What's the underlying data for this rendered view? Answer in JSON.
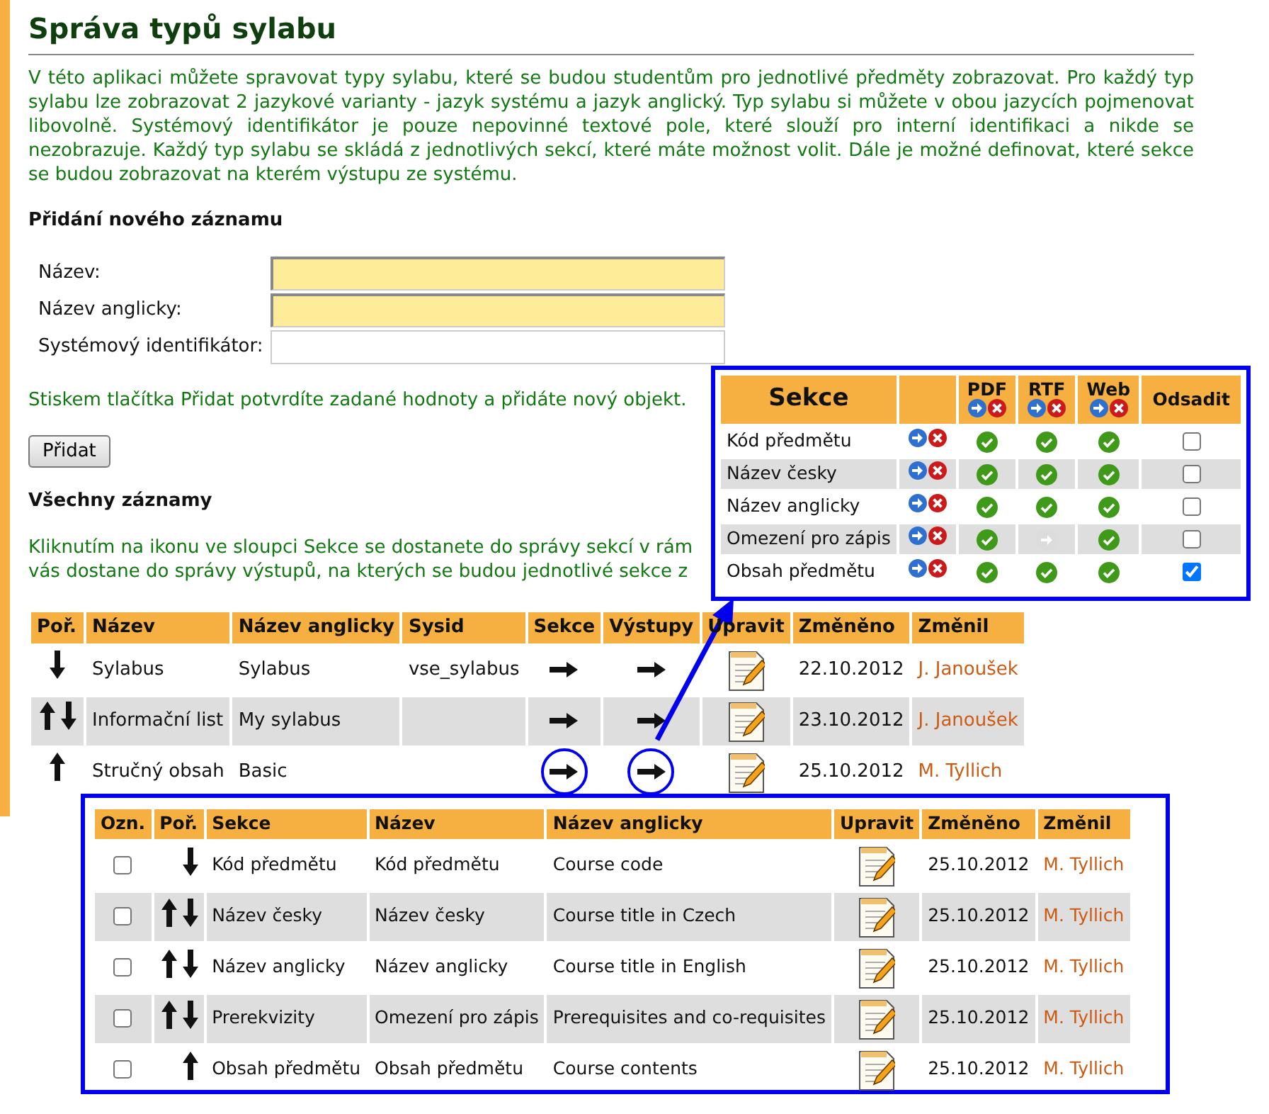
{
  "title": "Správa typů sylabu",
  "intro": "V této aplikaci můžete spravovat typy sylabu, které se budou studentům pro jednotlivé předměty zobrazovat. Pro každý typ sylabu lze zobrazovat 2 jazykové varianty - jazyk systému a jazyk anglický. Typ sylabu si můžete v obou jazycích pojmenovat libovolně. Systémový identifikátor je pouze nepovinné textové pole, které slouží pro interní identifikaci a nikde se nezobrazuje. Každý typ sylabu se skládá z jednotlivých sekcí, které máte možnost volit. Dále je možné definovat, které sekce se budou zobrazovat na kterém výstupu ze systému.",
  "add_form": {
    "heading": "Přidání nového záznamu",
    "fields": [
      {
        "label": "Název:",
        "required": true
      },
      {
        "label": "Název anglicky:",
        "required": true
      },
      {
        "label": "Systémový identifikátor:",
        "required": false
      }
    ],
    "hint": "Stiskem tlačítka Přidat potvrdíte zadané hodnoty a přidáte nový objekt.",
    "button": "Přidat"
  },
  "records": {
    "heading": "Všechny záznamy",
    "hint_lines": [
      "Kliknutím na ikonu ve sloupci Sekce se dostanete do správy sekcí v rám",
      "vás dostane do správy výstupů, na kterých se budou jednotlivé sekce z"
    ],
    "columns": [
      "Poř.",
      "Název",
      "Název anglicky",
      "Sysid",
      "Sekce",
      "Výstupy",
      "Upravit",
      "Změněno",
      "Změnil"
    ],
    "rows": [
      {
        "move_up": false,
        "move_down": true,
        "name": "Sylabus",
        "name_en": "Sylabus",
        "sysid": "vse_sylabus",
        "circled": false,
        "changed": "22.10.2012",
        "changed_by": "J. Janoušek"
      },
      {
        "move_up": true,
        "move_down": true,
        "name": "Informační list",
        "name_en": "My sylabus",
        "circled": false,
        "changed": "23.10.2012",
        "changed_by": "J. Janoušek"
      },
      {
        "move_up": true,
        "move_down": false,
        "name": "Stručný obsah",
        "name_en": "Basic",
        "circled": true,
        "changed": "25.10.2012",
        "changed_by": "M. Tyllich"
      }
    ]
  },
  "outputs_panel": {
    "section_header": "Sekce",
    "outputs": [
      "PDF",
      "RTF",
      "Web"
    ],
    "indent_header": "Odsadit",
    "rows": [
      {
        "name": "Kód předmětu",
        "outputs": [
          true,
          true,
          true
        ],
        "indent": false
      },
      {
        "name": "Název česky",
        "outputs": [
          true,
          true,
          true
        ],
        "indent": false
      },
      {
        "name": "Název anglicky",
        "outputs": [
          true,
          true,
          true
        ],
        "indent": false
      },
      {
        "name": "Omezení pro zápis",
        "outputs": [
          true,
          false,
          true
        ],
        "indent": false
      },
      {
        "name": "Obsah předmětu",
        "outputs": [
          true,
          true,
          true
        ],
        "indent": true
      }
    ]
  },
  "sections_panel": {
    "columns": [
      "Ozn.",
      "Poř.",
      "Sekce",
      "Název",
      "Název anglicky",
      "Upravit",
      "Změněno",
      "Změnil"
    ],
    "rows": [
      {
        "checked": false,
        "move_up": false,
        "move_down": true,
        "section": "Kód předmětu",
        "name": "Kód předmětu",
        "name_en": "Course code",
        "changed": "25.10.2012",
        "changed_by": "M. Tyllich"
      },
      {
        "checked": false,
        "move_up": true,
        "move_down": true,
        "section": "Název česky",
        "name": "Název česky",
        "name_en": "Course title in Czech",
        "changed": "25.10.2012",
        "changed_by": "M. Tyllich"
      },
      {
        "checked": false,
        "move_up": true,
        "move_down": true,
        "section": "Název anglicky",
        "name": "Název anglicky",
        "name_en": "Course title in English",
        "changed": "25.10.2012",
        "changed_by": "M. Tyllich"
      },
      {
        "checked": false,
        "move_up": true,
        "move_down": true,
        "section": "Prerekvizity",
        "name": "Omezení pro zápis",
        "name_en": "Prerequisites and co-requisites",
        "changed": "25.10.2012",
        "changed_by": "M. Tyllich"
      },
      {
        "checked": false,
        "move_up": true,
        "move_down": false,
        "section": "Obsah předmětu",
        "name": "Obsah předmětu",
        "name_en": "Course contents",
        "changed": "25.10.2012",
        "changed_by": "M. Tyllich"
      }
    ]
  }
}
